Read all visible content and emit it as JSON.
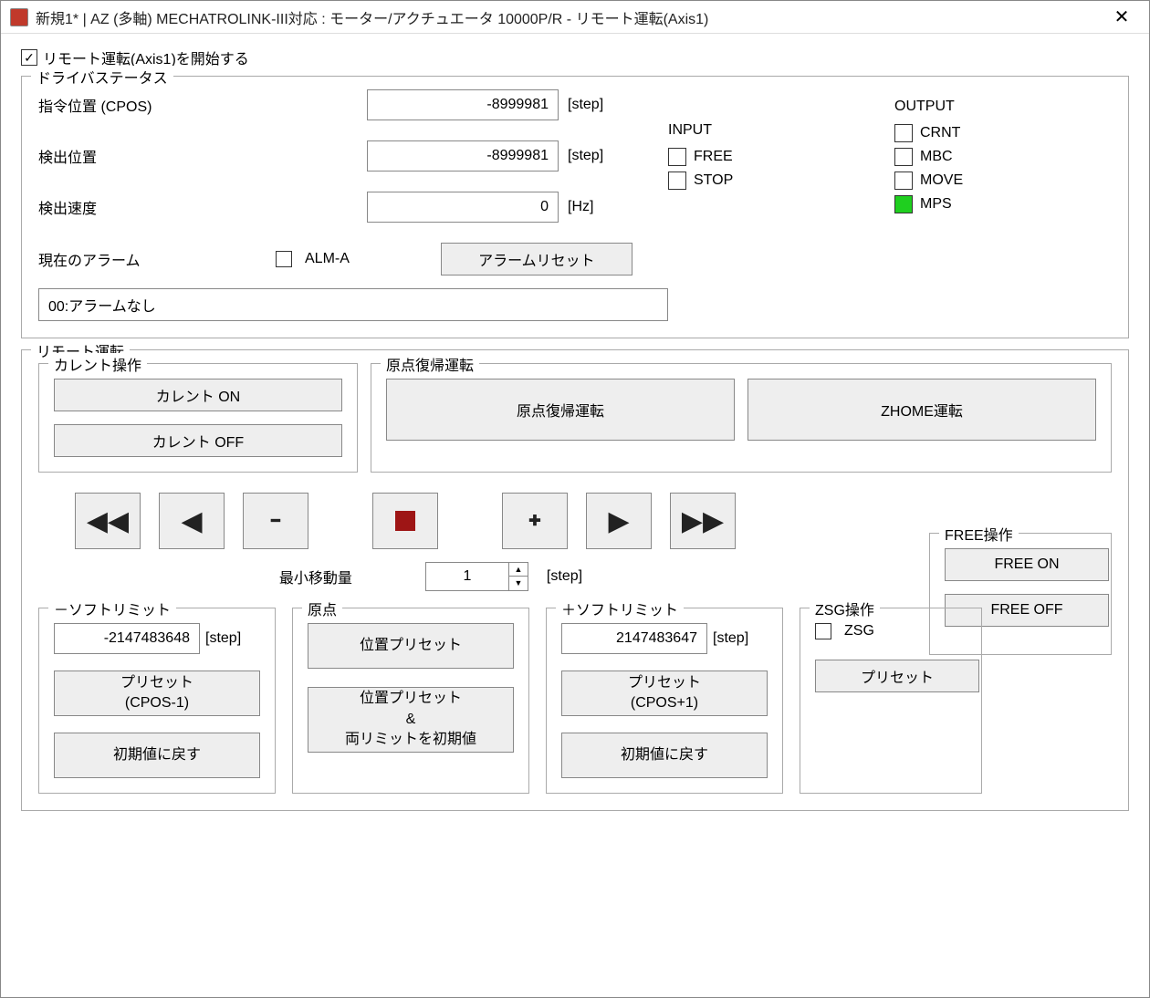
{
  "title": "新規1* | AZ (多軸) MECHATROLINK-III対応 : モーター/アクチュエータ 10000P/R - リモート運転(Axis1)",
  "start_checkbox": {
    "label": "リモート運転(Axis1)を開始する",
    "checked": true
  },
  "driver_status": {
    "title": "ドライバステータス",
    "rows": [
      {
        "label": "指令位置 (CPOS)",
        "value": "-8999981",
        "unit": "[step]"
      },
      {
        "label": "検出位置",
        "value": "-8999981",
        "unit": "[step]"
      },
      {
        "label": "検出速度",
        "value": "0",
        "unit": "[Hz]"
      }
    ],
    "input": {
      "title": "INPUT",
      "items": [
        {
          "label": "FREE",
          "on": false
        },
        {
          "label": "STOP",
          "on": false
        }
      ]
    },
    "output": {
      "title": "OUTPUT",
      "items": [
        {
          "label": "CRNT",
          "on": false
        },
        {
          "label": "MBC",
          "on": false
        },
        {
          "label": "MOVE",
          "on": false
        },
        {
          "label": "MPS",
          "on": true
        }
      ]
    },
    "alarm": {
      "label": "現在のアラーム",
      "alm_a": {
        "label": "ALM-A",
        "checked": false
      },
      "reset": "アラームリセット",
      "text": "00:アラームなし"
    }
  },
  "remote": {
    "title": "リモート運転",
    "current": {
      "title": "カレント操作",
      "on": "カレント ON",
      "off": "カレント OFF"
    },
    "homing": {
      "title": "原点復帰運転",
      "homing_btn": "原点復帰運転",
      "zhome_btn": "ZHOME運転"
    },
    "minmove": {
      "label": "最小移動量",
      "value": "1",
      "unit": "[step]"
    },
    "free": {
      "title": "FREE操作",
      "on": "FREE ON",
      "off": "FREE OFF"
    },
    "neg_limit": {
      "title": "－ソフトリミット",
      "value": "-2147483648",
      "unit": "[step]",
      "preset": "プリセット\n(CPOS-1)",
      "reset": "初期値に戻す"
    },
    "origin": {
      "title": "原点",
      "preset": "位置プリセット",
      "preset_both": "位置プリセット\n&\n両リミットを初期値"
    },
    "pos_limit": {
      "title": "＋ソフトリミット",
      "value": "2147483647",
      "unit": "[step]",
      "preset": "プリセット\n(CPOS+1)",
      "reset": "初期値に戻す"
    },
    "zsg": {
      "title": "ZSG操作",
      "zsg_label": "ZSG",
      "checked": false,
      "preset": "プリセット"
    }
  }
}
